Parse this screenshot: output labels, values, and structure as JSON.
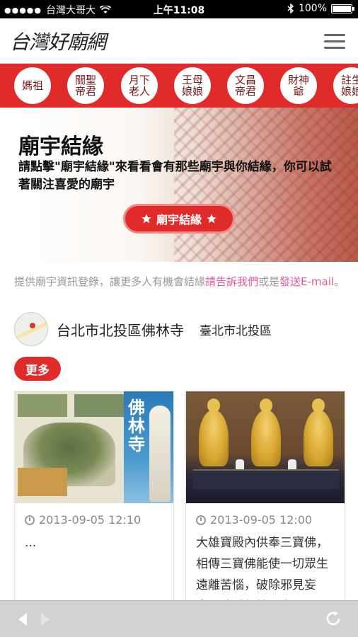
{
  "status_bar": {
    "carrier": "台灣大哥大",
    "signal": "●●●●●",
    "time": "上午11:08",
    "battery": "100%",
    "battery_level": 1.0
  },
  "header": {
    "logo_text": "台灣好廟網",
    "menu_icon": "hamburger-icon"
  },
  "gods": [
    {
      "label": "媽祖"
    },
    {
      "label": "關聖帝君"
    },
    {
      "label": "月下老人"
    },
    {
      "label": "王母娘娘"
    },
    {
      "label": "文昌帝君"
    },
    {
      "label": "財神爺"
    },
    {
      "label": "註生娘娘"
    }
  ],
  "banner": {
    "title": "廟宇結緣",
    "description": "請點擊\"廟宇結緣\"來看看會有那些廟宇與你結緣，你可以試著關注喜愛的廟宇",
    "cta_label": "廟宇結緣",
    "cta_icon": "star-icon"
  },
  "info": {
    "text_before": "提供廟宇資訊登錄，讓更多人有機會結緣",
    "link1": "請告訴我們",
    "text_middle": "或是",
    "link2": "發送E-mail",
    "text_after": "。"
  },
  "temple": {
    "name": "台北市北投區佛林寺",
    "district": "臺北市北投區",
    "map_icon": "map-thumbnail"
  },
  "more_button": "更多",
  "cards": [
    {
      "date": "2013-09-05 12:10",
      "text": "...",
      "cover_title": "佛林寺"
    },
    {
      "date": "2013-09-05 12:00",
      "text": "大雄寶殿內供奉三寶佛，相傳三寶佛能使一切眾生遠離苦惱，破除邪見妄念，消滅無始以來"
    }
  ],
  "toolbar": {
    "back_icon": "back-arrow-icon",
    "forward_icon": "forward-arrow-icon",
    "reload_icon": "reload-icon"
  },
  "colors": {
    "accent": "#e12a2a",
    "link": "#e8569b",
    "muted_text": "#999999"
  }
}
